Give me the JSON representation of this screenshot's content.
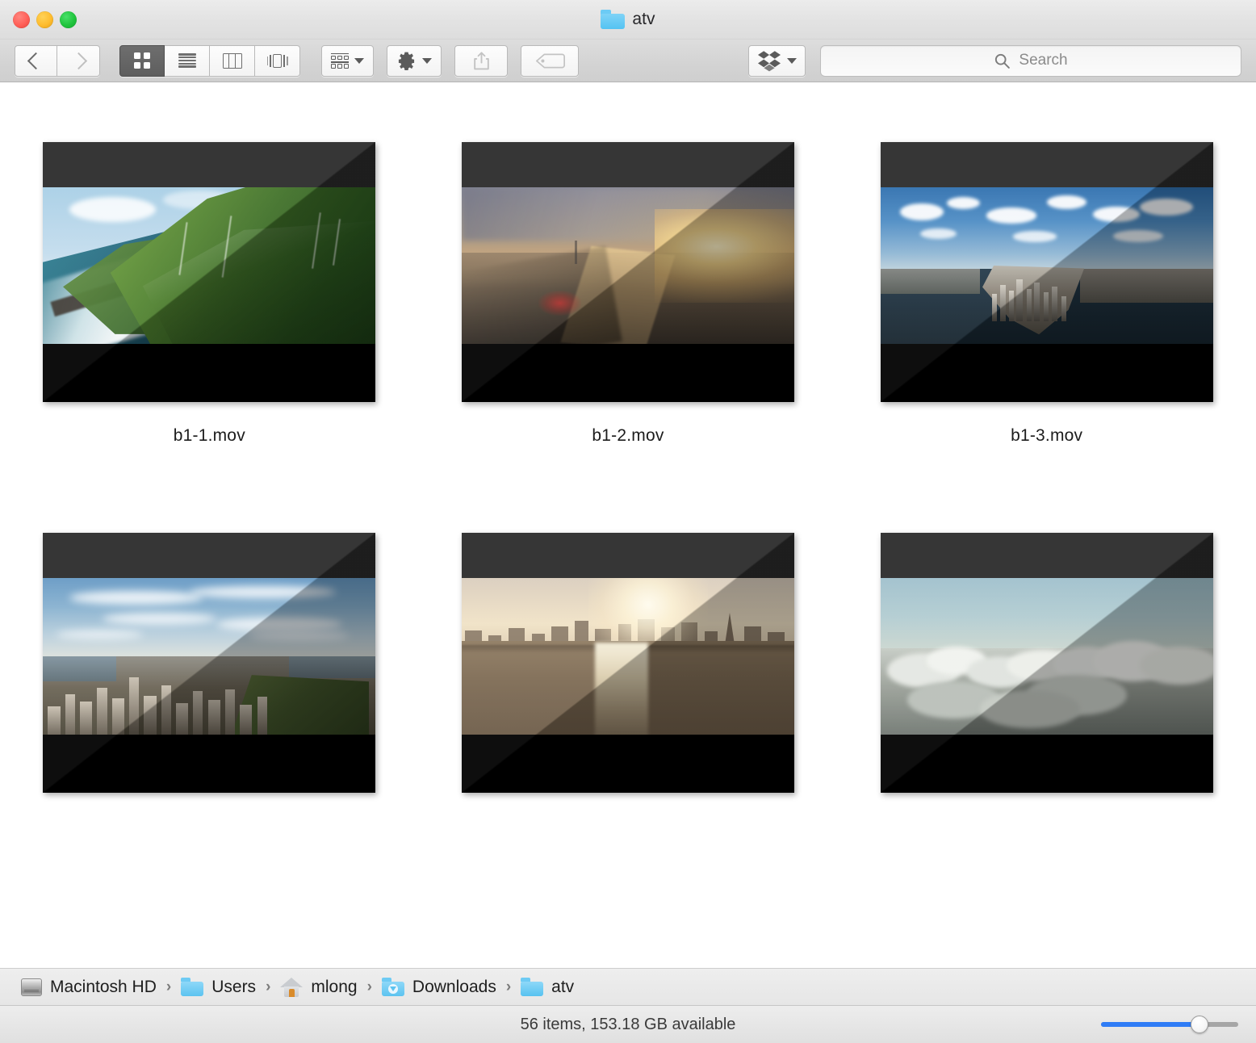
{
  "window": {
    "title": "atv",
    "title_folder_icon": "folder-icon",
    "traffic_lights": [
      {
        "name": "close-button",
        "color": "#ff5f57"
      },
      {
        "name": "minimize-button",
        "color": "#febc2e"
      },
      {
        "name": "maximize-button",
        "color": "#1fc43c"
      }
    ]
  },
  "toolbar": {
    "back_label": "Back",
    "forward_label": "Forward",
    "view_modes": [
      {
        "label": "Icon View",
        "icon": "grid-icon",
        "selected": true
      },
      {
        "label": "List View",
        "icon": "list-icon",
        "selected": false
      },
      {
        "label": "Column View",
        "icon": "columns-icon",
        "selected": false
      },
      {
        "label": "Cover Flow",
        "icon": "coverflow-icon",
        "selected": false
      }
    ],
    "arrange_label": "Arrange",
    "action_label": "Action",
    "share_label": "Share",
    "tags_label": "Edit Tags",
    "dropbox_label": "Dropbox",
    "accent_color": "#2f7cf6"
  },
  "search": {
    "placeholder": "Search",
    "value": "",
    "icon": "search-icon"
  },
  "files": [
    {
      "name": "b1-1.mov",
      "scene": "hawaii-coast"
    },
    {
      "name": "b1-2.mov",
      "scene": "london-sunset"
    },
    {
      "name": "b1-3.mov",
      "scene": "manhattan-downtown"
    },
    {
      "name": "",
      "scene": "manhattan-central-park"
    },
    {
      "name": "",
      "scene": "san-francisco-sunset"
    },
    {
      "name": "",
      "scene": "above-the-clouds"
    }
  ],
  "pathbar": {
    "crumbs": [
      {
        "label": "Macintosh HD",
        "icon": "harddisk-icon"
      },
      {
        "label": "Users",
        "icon": "users-folder-icon"
      },
      {
        "label": "mlong",
        "icon": "home-icon"
      },
      {
        "label": "Downloads",
        "icon": "downloads-folder-icon"
      },
      {
        "label": "atv",
        "icon": "folder-icon"
      }
    ],
    "separator": "›"
  },
  "statusbar": {
    "text": "56 items, 153.18 GB available",
    "zoom_percent": 72
  }
}
